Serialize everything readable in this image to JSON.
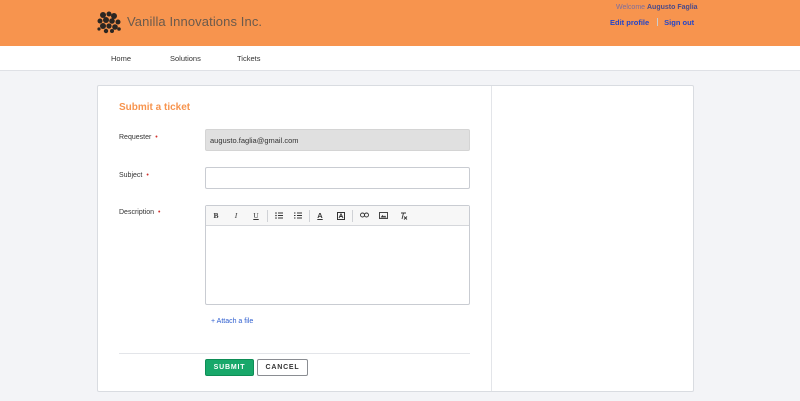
{
  "header": {
    "brand": "Vanilla Innovations Inc.",
    "welcome_prefix": "Welcome",
    "user_name": "Augusto Faglia",
    "edit_profile": "Edit profile",
    "sign_out": "Sign out"
  },
  "nav": {
    "items": [
      {
        "label": "Home"
      },
      {
        "label": "Solutions"
      },
      {
        "label": "Tickets"
      }
    ]
  },
  "form": {
    "title": "Submit a ticket",
    "requester": {
      "label": "Requester",
      "required_mark": "•",
      "value": "augusto.faglia@gmail.com"
    },
    "subject": {
      "label": "Subject",
      "required_mark": "•",
      "value": ""
    },
    "description": {
      "label": "Description",
      "required_mark": "•",
      "value": ""
    },
    "toolbar": {
      "bold": "B",
      "italic": "I",
      "underline": "U",
      "font_color": "A"
    },
    "attach_label": "+ Attach a file",
    "submit_label": "SUBMIT",
    "cancel_label": "CANCEL"
  },
  "colors": {
    "header_bg": "#f7944e",
    "accent": "#f7944e",
    "submit_bg": "#18a86a",
    "link": "#2346c9",
    "required": "#d2322d"
  }
}
